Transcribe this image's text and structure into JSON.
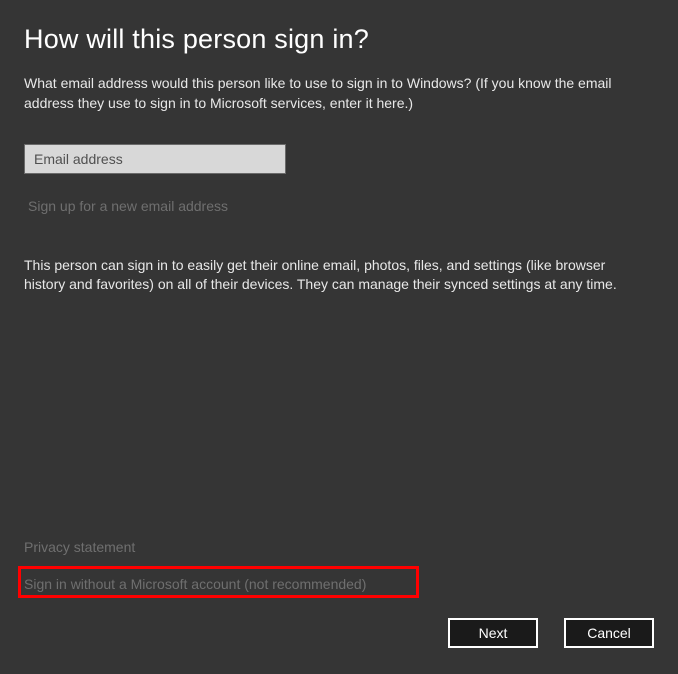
{
  "title": "How will this person sign in?",
  "instruction": "What email address would this person like to use to sign in to Windows? (If you know the email address they use to sign in to Microsoft services, enter it here.)",
  "email": {
    "value": "",
    "placeholder": "Email address"
  },
  "signup_link": "Sign up for a new email address",
  "description": "This person can sign in to easily get their online email, photos, files, and settings (like browser history and favorites) on all of their devices. They can manage their synced settings at any time.",
  "privacy_link": "Privacy statement",
  "no_account_link": "Sign in without a Microsoft account (not recommended)",
  "buttons": {
    "next": "Next",
    "cancel": "Cancel"
  }
}
